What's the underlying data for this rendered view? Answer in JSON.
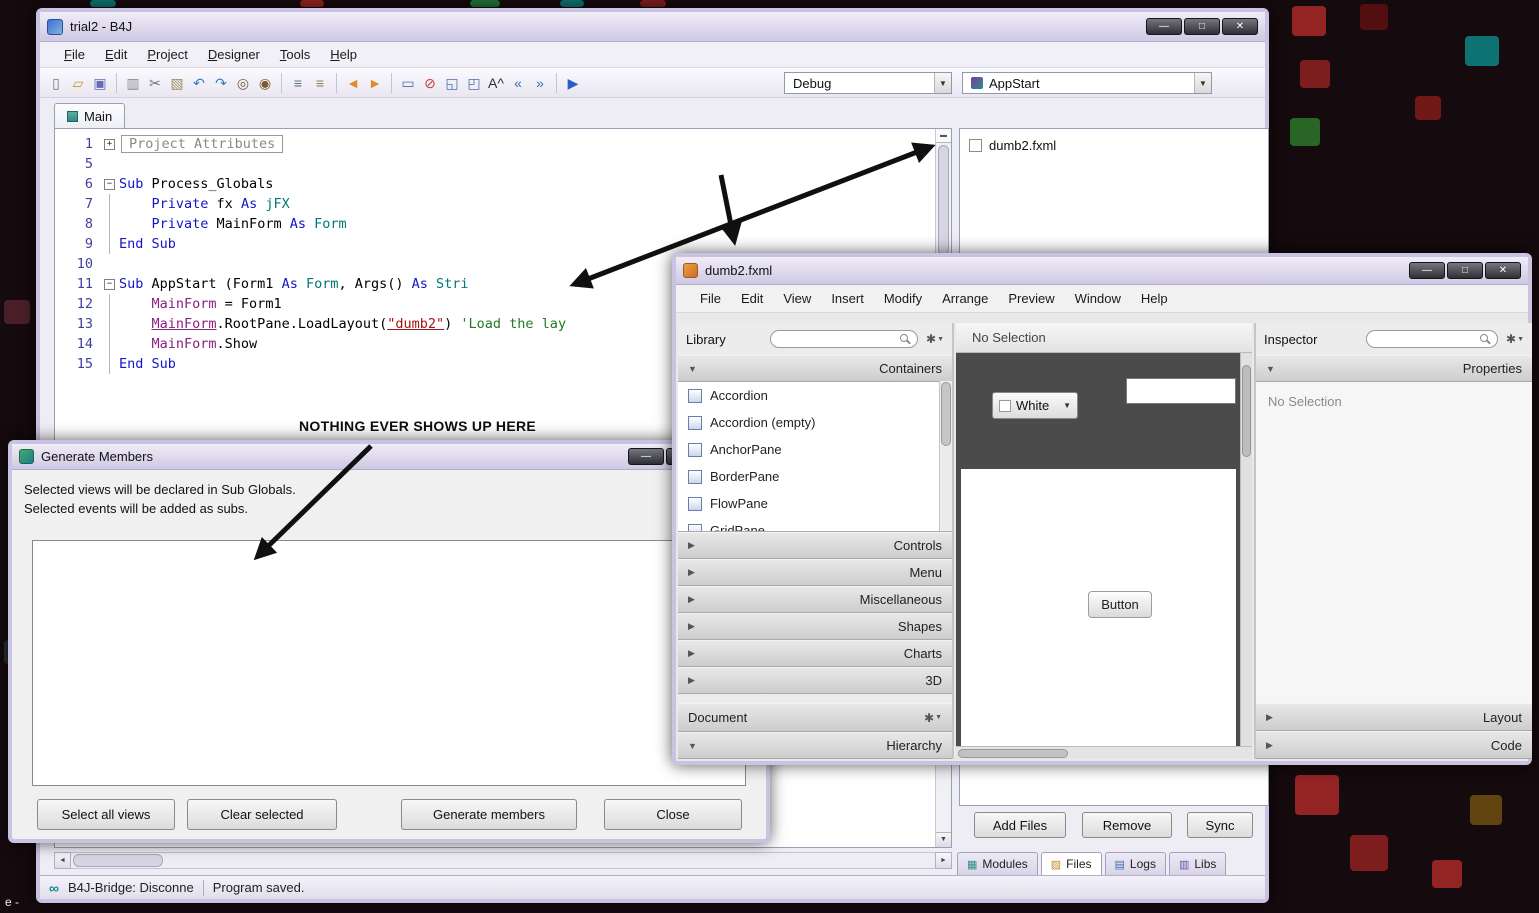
{
  "desktop": {
    "corner_text": "e -"
  },
  "chrome": {
    "minimize": "—",
    "maximize": "□",
    "close": "✕",
    "dropdown": "▼",
    "expanded": "▼",
    "collapsed": "▶",
    "gear": "✱",
    "left_arrow": "◄",
    "right_arrow": "►",
    "down_arrow": "▼",
    "splitter": "▬"
  },
  "main_window": {
    "title": "trial2 - B4J",
    "menu": [
      "File",
      "Edit",
      "Project",
      "Designer",
      "Tools",
      "Help"
    ],
    "toolbar": {
      "icons": [
        {
          "name": "new-file-icon",
          "glyph": "▯",
          "color": "#777777"
        },
        {
          "name": "open-project-icon",
          "glyph": "▱",
          "color": "#c29a2e"
        },
        {
          "name": "save-icon",
          "glyph": "▣",
          "color": "#6868b8"
        },
        {
          "sep": true
        },
        {
          "name": "copy-icon",
          "glyph": "▥",
          "color": "#8a8a8a"
        },
        {
          "name": "cut-icon",
          "glyph": "✂",
          "color": "#707070"
        },
        {
          "name": "paste-icon",
          "glyph": "▧",
          "color": "#9a8d60"
        },
        {
          "name": "undo-icon",
          "glyph": "↶",
          "color": "#2f7fbf"
        },
        {
          "name": "redo-icon",
          "glyph": "↷",
          "color": "#2f7fbf"
        },
        {
          "name": "search-icon",
          "glyph": "◎",
          "color": "#7a5a32"
        },
        {
          "name": "search-all-icon",
          "glyph": "◉",
          "color": "#7a5a32"
        },
        {
          "sep": true
        },
        {
          "name": "comment-icon",
          "glyph": "≡",
          "color": "#5a7090"
        },
        {
          "name": "format-icon",
          "glyph": "≡",
          "color": "#907a5a"
        },
        {
          "sep": true
        },
        {
          "name": "back-icon",
          "glyph": "◄",
          "color": "#e08a2e"
        },
        {
          "name": "forward-icon",
          "glyph": "►",
          "color": "#e08a2e"
        },
        {
          "sep": true
        },
        {
          "name": "designer-script-icon",
          "glyph": "▭",
          "color": "#4a6fae"
        },
        {
          "name": "close-tabs-icon",
          "glyph": "⊘",
          "color": "#c23b3b"
        },
        {
          "name": "bridge-icon",
          "glyph": "◱",
          "color": "#4a6fae"
        },
        {
          "name": "bridge-reconnect-icon",
          "glyph": "◰",
          "color": "#4a6fae"
        },
        {
          "name": "font-size-icon",
          "glyph": "A^",
          "color": "#303030"
        },
        {
          "name": "outdent-icon",
          "glyph": "«",
          "color": "#3a6faf"
        },
        {
          "name": "indent-icon",
          "glyph": "»",
          "color": "#3a6faf"
        },
        {
          "sep": true
        },
        {
          "name": "run-icon",
          "glyph": "▶",
          "color": "#2b5cc8"
        }
      ],
      "debug_combo": "Debug",
      "appstart_combo": "AppStart"
    },
    "tab": "Main",
    "editor": {
      "lines": [
        {
          "n": "1",
          "f": "+",
          "t": [
            [
              "b",
              "Project Attributes"
            ]
          ]
        },
        {
          "n": "5",
          "t": []
        },
        {
          "n": "6",
          "f": "-",
          "t": [
            [
              "k",
              "Sub"
            ],
            [
              "p",
              " Process_Globals"
            ]
          ]
        },
        {
          "n": "7",
          "g": 1,
          "t": [
            [
              "p",
              "    "
            ],
            [
              "k",
              "Private"
            ],
            [
              "p",
              " fx "
            ],
            [
              "k",
              "As"
            ],
            [
              "p",
              " "
            ],
            [
              "y",
              "jFX"
            ]
          ]
        },
        {
          "n": "8",
          "g": 1,
          "t": [
            [
              "p",
              "    "
            ],
            [
              "k",
              "Private"
            ],
            [
              "p",
              " MainForm "
            ],
            [
              "k",
              "As"
            ],
            [
              "p",
              " "
            ],
            [
              "y",
              "Form"
            ]
          ]
        },
        {
          "n": "9",
          "g": 1,
          "t": [
            [
              "k",
              "End Sub"
            ]
          ]
        },
        {
          "n": "10",
          "t": []
        },
        {
          "n": "11",
          "f": "-",
          "t": [
            [
              "k",
              "Sub"
            ],
            [
              "p",
              " AppStart (Form1 "
            ],
            [
              "k",
              "As"
            ],
            [
              "p",
              " "
            ],
            [
              "y",
              "Form"
            ],
            [
              "p",
              ", Args() "
            ],
            [
              "k",
              "As"
            ],
            [
              "p",
              " "
            ],
            [
              "y",
              "Stri"
            ]
          ]
        },
        {
          "n": "12",
          "g": 1,
          "t": [
            [
              "p",
              "    "
            ],
            [
              "v",
              "MainForm"
            ],
            [
              "p",
              " = Form1"
            ]
          ]
        },
        {
          "n": "13",
          "g": 1,
          "t": [
            [
              "p",
              "    "
            ],
            [
              "u",
              "MainForm"
            ],
            [
              "p",
              ".RootPane.LoadLayout("
            ],
            [
              "s",
              "\"dumb2\""
            ],
            [
              "p",
              ") "
            ],
            [
              "c",
              "'Load the lay"
            ]
          ]
        },
        {
          "n": "14",
          "g": 1,
          "t": [
            [
              "p",
              "    "
            ],
            [
              "v",
              "MainForm"
            ],
            [
              "p",
              ".Show"
            ]
          ]
        },
        {
          "n": "15",
          "g": 1,
          "t": [
            [
              "k",
              "End Sub"
            ]
          ]
        }
      ]
    },
    "annotation": "NOTHING EVER SHOWS UP HERE",
    "files_panel": {
      "items": [
        {
          "label": "dumb2.fxml"
        }
      ]
    },
    "buttons": {
      "add_files": "Add Files",
      "remove": "Remove",
      "sync": "Sync"
    },
    "bottom_tabs": [
      {
        "label": "Modules",
        "glyph": "▦",
        "color": "#2e8b8b",
        "selected": false
      },
      {
        "label": "Files",
        "glyph": "▨",
        "color": "#c08a28",
        "selected": true
      },
      {
        "label": "Logs",
        "glyph": "▤",
        "color": "#3d6cae",
        "selected": false
      },
      {
        "label": "Libs",
        "glyph": "▥",
        "color": "#6d4fa0",
        "selected": false
      }
    ],
    "status": {
      "bridge": "B4J-Bridge: Disconne",
      "saved": "Program saved."
    }
  },
  "designer_window": {
    "title": "dumb2.fxml",
    "menu": [
      "File",
      "Edit",
      "View",
      "Insert",
      "Modify",
      "Arrange",
      "Preview",
      "Window",
      "Help"
    ],
    "library": {
      "title": "Library",
      "sections": {
        "containers": "Containers",
        "controls": "Controls",
        "menu": "Menu",
        "miscellaneous": "Miscellaneous",
        "shapes": "Shapes",
        "charts": "Charts",
        "three_d": "3D",
        "document": "Document",
        "hierarchy": "Hierarchy"
      },
      "items": [
        {
          "label": "Accordion"
        },
        {
          "label": "Accordion  (empty)"
        },
        {
          "label": "AnchorPane"
        },
        {
          "label": "BorderPane"
        },
        {
          "label": "FlowPane"
        },
        {
          "label": "GridPane"
        }
      ]
    },
    "canvas": {
      "header": "No Selection",
      "background_combo": "White",
      "button_label": "Button"
    },
    "inspector": {
      "title": "Inspector",
      "properties": "Properties",
      "empty": "No Selection",
      "layout": "Layout",
      "code": "Code"
    }
  },
  "dialog": {
    "title": "Generate Members",
    "line1": "Selected views will be declared in Sub Globals.",
    "line2": "Selected events will be added as subs.",
    "buttons": [
      {
        "label": "Select all views",
        "name": "select-all-views-button"
      },
      {
        "label": "Clear selected",
        "name": "clear-selected-button"
      },
      {
        "label": "Generate members",
        "name": "generate-members-button"
      },
      {
        "label": "Close",
        "name": "close-button"
      }
    ]
  }
}
